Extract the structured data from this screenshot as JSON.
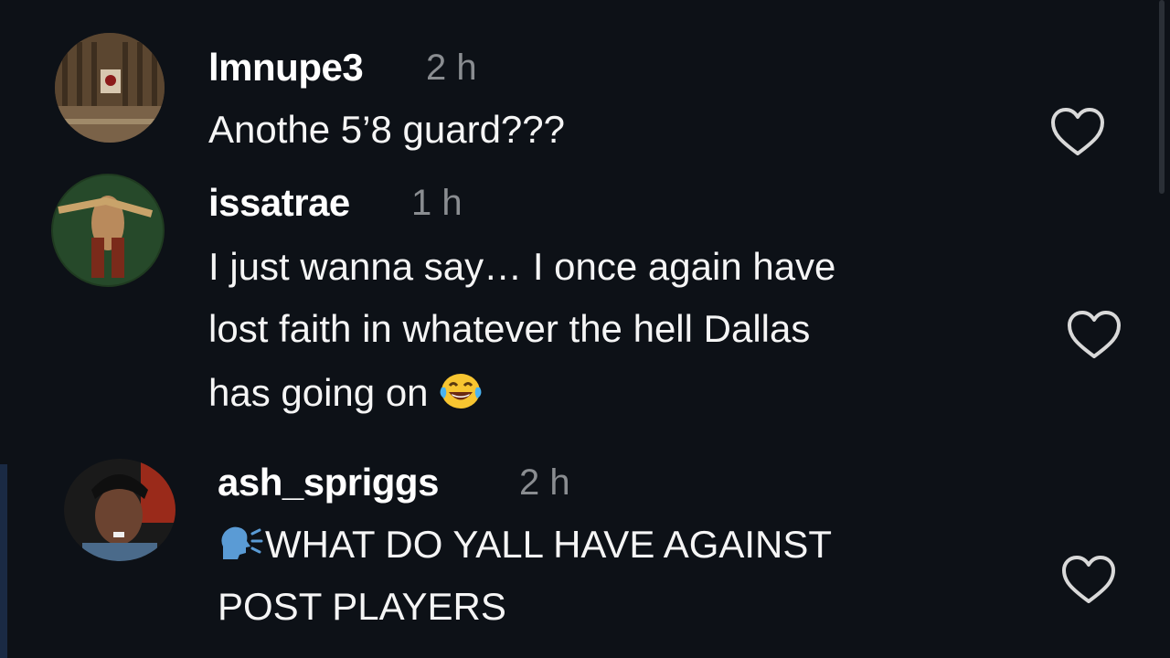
{
  "comments": [
    {
      "username": "lmnupe3",
      "time": "2 h",
      "lines": [
        "Anothe 5’8 guard???"
      ],
      "like_icon": "heart-outline-icon"
    },
    {
      "username": "issatrae",
      "time": "1 h",
      "lines": [
        "I just wanna say… I once again have",
        "lost faith in whatever the hell Dallas",
        "has going on"
      ],
      "emoji": "laughing-crying-emoji",
      "like_icon": "heart-outline-icon"
    },
    {
      "username": "ash_spriggs",
      "time": "2 h",
      "lines": [
        "WHAT DO YALL HAVE AGAINST",
        "POST PLAYERS"
      ],
      "leading_emoji": "speaking-head-emoji",
      "like_icon": "heart-outline-icon"
    }
  ],
  "colors": {
    "background": "#0d1117",
    "text": "#ffffff",
    "timestamp": "#8a8d91"
  }
}
